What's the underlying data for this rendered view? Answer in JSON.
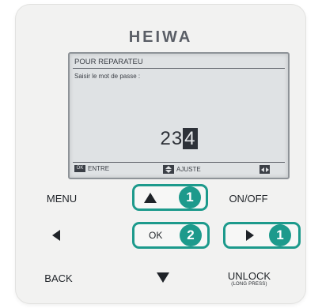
{
  "brand": "HEIWA",
  "screen": {
    "title": "POUR REPARATEU",
    "prompt": "Saisir le mot de passe :",
    "code_digits": "23",
    "code_selected": "4",
    "footer": {
      "enter_label": "ENTRE",
      "adjust_label": "AJUSTE"
    }
  },
  "buttons": {
    "menu": "MENU",
    "onoff": "ON/OFF",
    "ok": "OK",
    "back": "BACK",
    "unlock": "UNLOCK",
    "unlock_sub": "(LONG PRESS)"
  },
  "callouts": {
    "up_badge": "1",
    "ok_badge": "2",
    "right_badge": "1"
  },
  "colors": {
    "accent": "#1d9a8c",
    "panel": "#f2f2f1",
    "lcd": "#dfe2e4"
  }
}
